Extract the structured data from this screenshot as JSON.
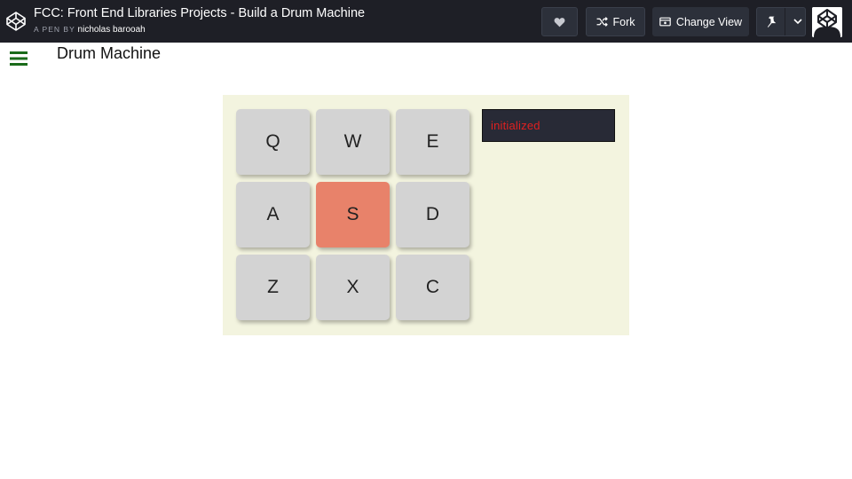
{
  "header": {
    "title": "FCC: Front End Libraries Projects - Build a Drum Machine",
    "byline_prefix": "A PEN BY",
    "author": "nicholas barooah",
    "fork_label": "Fork",
    "change_view_label": "Change View",
    "icons": {
      "logo": "codepen-logo-icon",
      "heart": "heart-icon",
      "fork": "fork-icon",
      "view": "change-view-icon",
      "pin": "pin-icon",
      "caret": "chevron-down-icon"
    }
  },
  "page": {
    "title": "Drum Machine",
    "menu_icon": "hamburger-menu-icon",
    "menu_color": "#1a6b1a"
  },
  "drum_machine": {
    "display_text": "initialized",
    "display_text_color": "#e02020",
    "pad_color": "#d3d3d3",
    "active_pad_color": "#e8826a",
    "active_pad": "S",
    "pads": [
      "Q",
      "W",
      "E",
      "A",
      "S",
      "D",
      "Z",
      "X",
      "C"
    ]
  }
}
